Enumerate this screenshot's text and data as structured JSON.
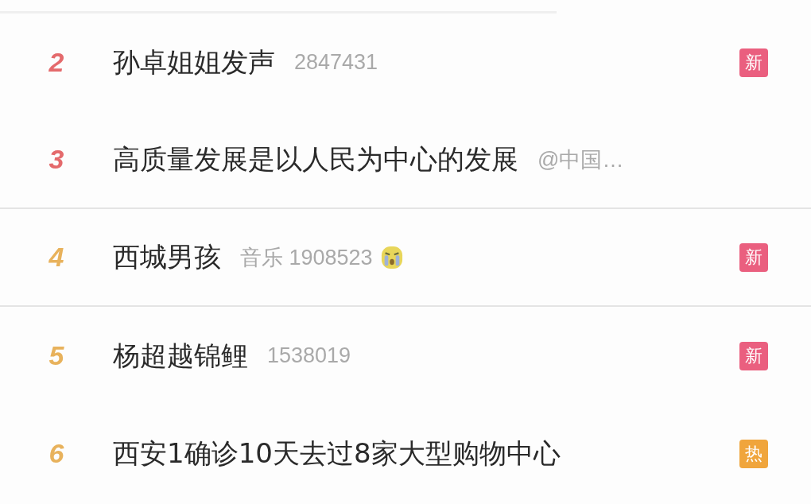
{
  "hot_list": [
    {
      "rank": "2",
      "color": "#e46a6c",
      "title": "孙卓姐姐发声",
      "meta": "2847431",
      "emoji": false,
      "badge": {
        "text": "新",
        "kind": "new"
      },
      "divider_below": false
    },
    {
      "rank": "3",
      "color": "#e46a6c",
      "title": "高质量发展是以人民为中心的发展",
      "meta": "@中国…",
      "emoji": false,
      "divider_below": true
    },
    {
      "rank": "4",
      "color": "#e8b25c",
      "title": "西城男孩",
      "meta": "音乐 1908523",
      "emoji": true,
      "badge": {
        "text": "新",
        "kind": "new"
      },
      "divider_below": true
    },
    {
      "rank": "5",
      "color": "#e8b25c",
      "title": "杨超越锦鲤",
      "meta": "1538019",
      "emoji": false,
      "badge": {
        "text": "新",
        "kind": "new"
      },
      "divider_below": false
    },
    {
      "rank": "6",
      "color": "#e8b25c",
      "title": "西安1确诊10天去过8家大型购物中心",
      "emoji": false,
      "badge": {
        "text": "热",
        "kind": "hot"
      },
      "divider_below": false
    }
  ]
}
